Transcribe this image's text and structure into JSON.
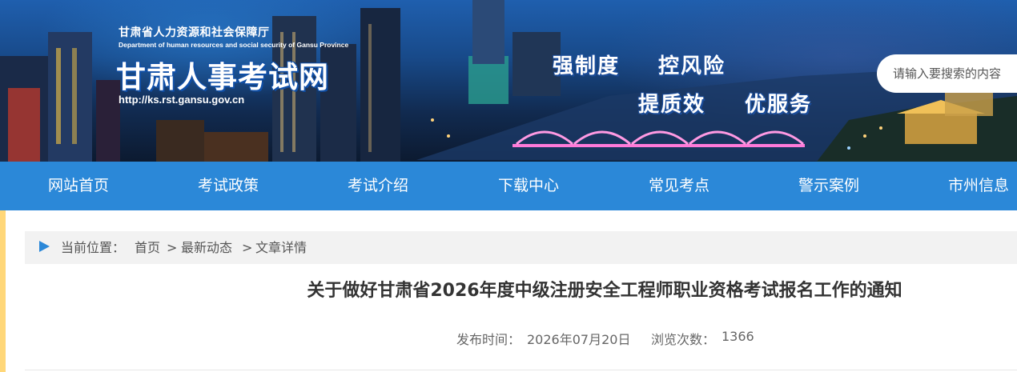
{
  "header": {
    "agency_cn": "甘肃省人力资源和社会保障厅",
    "agency_en": "Department of human resources and social security of Gansu Province",
    "site_title": "甘肃人事考试网",
    "site_url": "http://ks.rst.gansu.gov.cn",
    "slogans": [
      "强制度",
      "控风险",
      "提质效",
      "优服务"
    ],
    "search": {
      "placeholder": "请输入要搜索的内容",
      "value": ""
    }
  },
  "nav": {
    "items": [
      {
        "label": "网站首页"
      },
      {
        "label": "考试政策"
      },
      {
        "label": "考试介绍"
      },
      {
        "label": "下载中心"
      },
      {
        "label": "常见考点"
      },
      {
        "label": "警示案例"
      },
      {
        "label": "市州信息"
      }
    ]
  },
  "breadcrumb": {
    "prefix": "当前位置：",
    "items": [
      {
        "label": "首页"
      },
      {
        "label": "最新动态"
      },
      {
        "label": "文章详情"
      }
    ],
    "separator": ">"
  },
  "article": {
    "title": "关于做好甘肃省2026年度中级注册安全工程师职业资格考试报名工作的通知",
    "publish_label": "发布时间：",
    "publish_date": "2026年07月20日",
    "views_label": "浏览次数：",
    "views": "1366"
  },
  "colors": {
    "nav_bg": "#2b88d8",
    "accent_bar": "#ffd779",
    "breadcrumb_bg": "#f2f2f2"
  }
}
